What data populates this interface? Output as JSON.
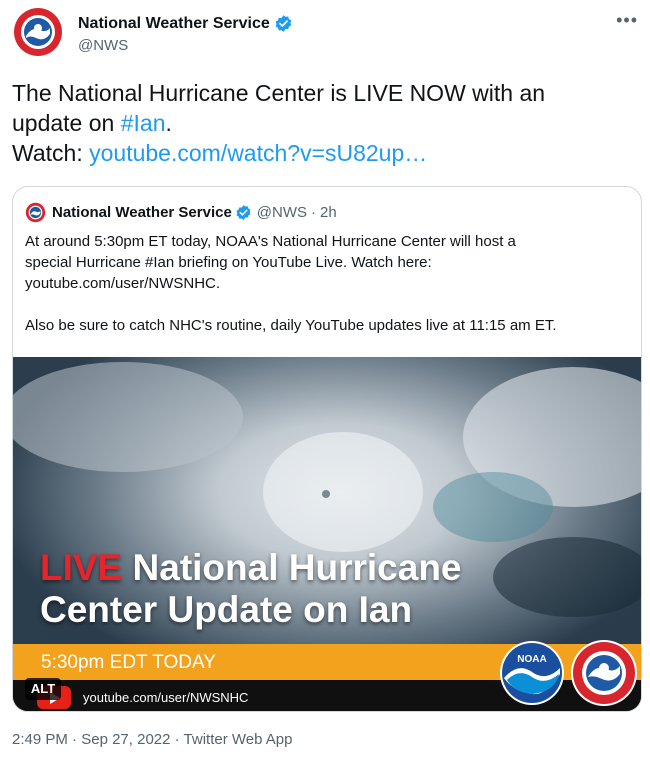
{
  "tweet": {
    "author_name": "National Weather Service",
    "author_handle": "@NWS",
    "text_line1": "The National Hurricane Center is LIVE NOW with an",
    "text_line2_prefix": "update on ",
    "hashtag": "#Ian",
    "text_line2_suffix": ".",
    "watch_label": "Watch: ",
    "watch_link": "youtube.com/watch?v=sU82up…",
    "more_icon": "more-icon"
  },
  "quote": {
    "author_name": "National Weather Service",
    "author_handle": "@NWS",
    "separator": "·",
    "time_ago": "2h",
    "body_lines": [
      "At around 5:30pm ET today, NOAA's National Hurricane Center will host a",
      "special Hurricane #Ian briefing on YouTube Live. Watch here:",
      "youtube.com/user/NWSNHC."
    ],
    "body_para2": "Also be sure to catch NHC's routine, daily YouTube updates live at 11:15 am ET."
  },
  "media": {
    "live_word": "LIVE",
    "title_line1_rest": " National Hurricane",
    "title_line2": "Center Update on Ian",
    "time_text": "5:30pm EDT TODAY",
    "yt_url": "youtube.com/user/NWSNHC",
    "alt_label": "ALT",
    "noaa_text": "NOAA",
    "colors": {
      "live_red": "#e4252b",
      "orange_bar": "#f2a21c",
      "link_blue": "#1d9bf0"
    }
  },
  "footer": {
    "time": "2:49 PM",
    "separator": " · ",
    "date": "Sep 27, 2022",
    "app": "Twitter Web App"
  }
}
